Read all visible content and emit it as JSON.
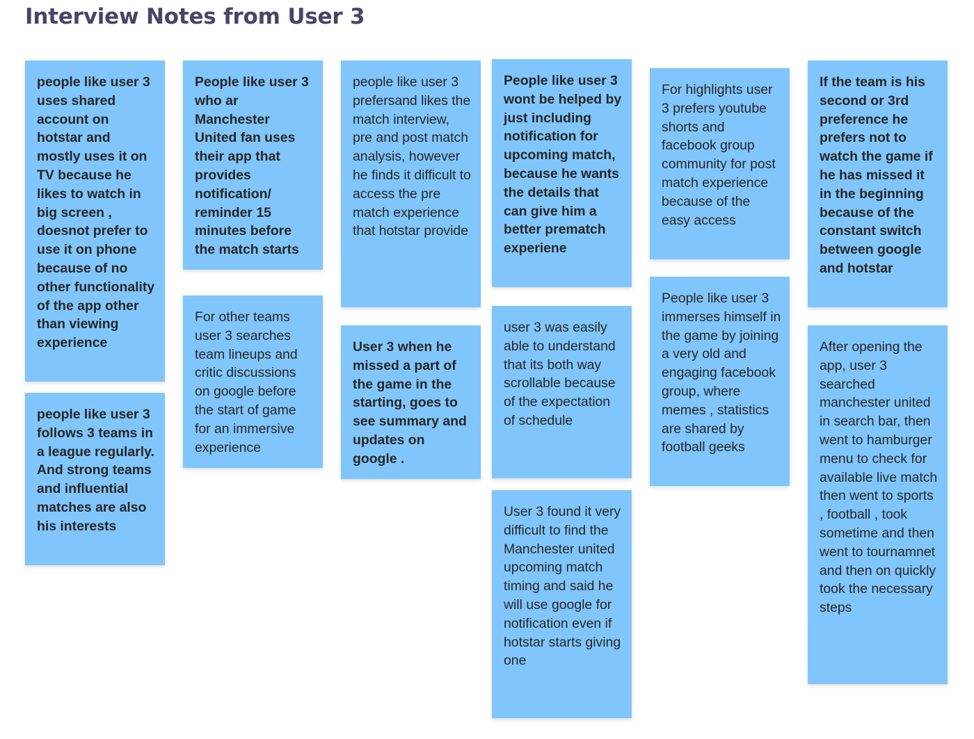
{
  "title": "Interview Notes from User 3",
  "note_color": "#80c6fc",
  "notes": [
    {
      "id": "n1",
      "bold": true,
      "text": "people like user 3 uses shared account on hotstar and mostly uses it on TV because he likes to watch in big screen , doesnot prefer to use it on phone because of no other functionality of the app other than viewing experience"
    },
    {
      "id": "n2",
      "bold": true,
      "text": "people like user 3 follows 3 teams in a league regularly. And strong teams and influential matches are also his interests"
    },
    {
      "id": "n3",
      "bold": true,
      "text": "People like user 3 who ar Manchester United fan uses their app that provides notification/ reminder 15 minutes before the match starts"
    },
    {
      "id": "n4",
      "bold": false,
      "text": "For other teams user 3 searches team lineups and critic discussions on google before the start of game for an immersive experience"
    },
    {
      "id": "n5",
      "bold": false,
      "text": "people like user 3 prefersand likes the match interview, pre and post match analysis, however he finds it difficult to access the pre match experience that hotstar provide"
    },
    {
      "id": "n6",
      "bold": true,
      "text": "User 3 when he missed a part of the game in the starting, goes to see summary and updates on google ."
    },
    {
      "id": "n7",
      "bold": true,
      "text": "People like user 3 wont be helped by just including notification for upcoming match, because he wants the details that can give him a better prematch experiene"
    },
    {
      "id": "n8",
      "bold": false,
      "text": "user 3 was easily able to understand that its both way scrollable because of the expectation of schedule"
    },
    {
      "id": "n9",
      "bold": false,
      "text": "User 3 found it very difficult to find the Manchester united upcoming match timing and said he will use google for notification even if hotstar starts giving one"
    },
    {
      "id": "n10",
      "bold": false,
      "text": "For highlights user 3 prefers youtube shorts and facebook group community for post match experience because of the easy access"
    },
    {
      "id": "n11",
      "bold": false,
      "text": "People like user 3 immerses himself in the game by joining a very old and engaging facebook group, where memes , statistics are shared by football geeks"
    },
    {
      "id": "n12",
      "bold": true,
      "text": "If the team is his second or 3rd preference he prefers not to watch the game if he has missed it in the beginning because of the constant switch between google and hotstar"
    },
    {
      "id": "n13",
      "bold": false,
      "text": "After opening the app, user 3 searched manchester united in search bar, then went to hamburger menu to check for available live match then went to sports , football , took sometime and then went to tournamnet and then on quickly took the necessary steps"
    }
  ]
}
